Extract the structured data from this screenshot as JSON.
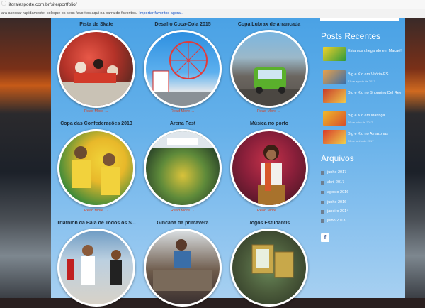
{
  "browser": {
    "url": "litoralesporte.com.br/site/portfolio/",
    "bookmarks_text": "ara acessar rapidamente, coloque os seus favoritos aqui na barra de favoritos.",
    "bookmarks_link": "Importar favoritos agora..."
  },
  "portfolio": [
    {
      "title": "Pista de Skate",
      "more": "Read More →"
    },
    {
      "title": "Desafio Coca-Cola 2015",
      "more": "Read More →"
    },
    {
      "title": "Copa Lubrax de arrancada",
      "more": "Read More →"
    },
    {
      "title": "Copa das Confederações 2013",
      "more": "Read More →"
    },
    {
      "title": "Arena Fest",
      "more": "Read More →"
    },
    {
      "title": "Música no porto",
      "more": "Read More →"
    },
    {
      "title": "Triathlon da Baía de Todos os S...",
      "more": ""
    },
    {
      "title": "Gincana da primavera",
      "more": ""
    },
    {
      "title": "Jogos Estudantis",
      "more": ""
    }
  ],
  "sidebar": {
    "recent_title": "Posts Recentes",
    "posts": [
      {
        "title": "Estamos chegando em Macaé!",
        "date": "15 de outubro de 2017"
      },
      {
        "title": "Big e Kid em Vitória-ES",
        "date": "21 de agosto de 2017"
      },
      {
        "title": "Big e Kid no Shopping Del Rey",
        "date": "3 de agosto de 2017"
      },
      {
        "title": "Big e Kid em Maringá",
        "date": "26 de julho de 2017"
      },
      {
        "title": "Big e Kid no Amazonas",
        "date": "26 de junho de 2017"
      }
    ],
    "archives_title": "Arquivos",
    "archives": [
      "junho 2017",
      "abril 2017",
      "agosto 2016",
      "junho 2016",
      "janeiro 2014",
      "julho 2013"
    ],
    "facebook": "f"
  }
}
